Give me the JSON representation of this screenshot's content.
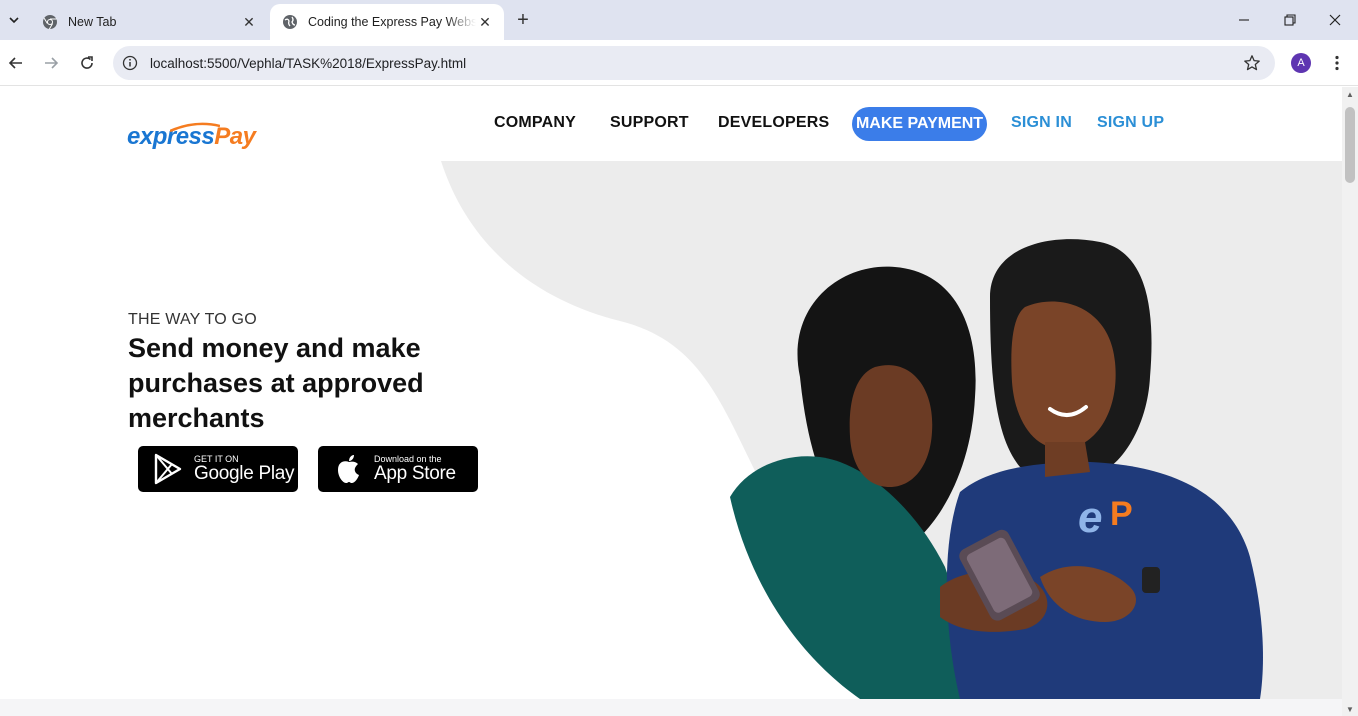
{
  "browser": {
    "tabs": [
      {
        "title": "New Tab",
        "active": false
      },
      {
        "title": "Coding the Express Pay Website",
        "active": true
      }
    ],
    "url": "localhost:5500/Vephla/TASK%2018/ExpressPay.html",
    "profile_initial": "A"
  },
  "site": {
    "logo": {
      "part1": "express",
      "part2": "Pay"
    },
    "nav": {
      "company": "COMPANY",
      "support": "SUPPORT",
      "developers": "DEVELOPERS",
      "make_payment": "MAKE PAYMENT",
      "sign_in": "SIGN IN",
      "sign_up": "SIGN UP"
    },
    "hero": {
      "eyebrow": "THE WAY TO GO",
      "headline": "Send money and make purchases at approved merchants"
    },
    "stores": {
      "google": {
        "small": "GET IT ON",
        "big": "Google Play"
      },
      "apple": {
        "small": "Download on the",
        "big": "App Store"
      }
    },
    "shirt_logo": {
      "e": "e",
      "p": "P"
    }
  },
  "colors": {
    "cta": "#3b7de9",
    "link": "#2b8fd6",
    "logo_blue": "#1976d2",
    "logo_orange": "#f57c20",
    "hero_shape": "#ececec"
  },
  "icons": [
    "chevron-down-icon",
    "chrome-icon",
    "globe-icon",
    "close-icon",
    "plus-icon",
    "minimize-icon",
    "restore-icon",
    "back-arrow-icon",
    "forward-arrow-icon",
    "reload-icon",
    "info-icon",
    "star-icon",
    "more-vert-icon",
    "google-play-icon",
    "apple-icon"
  ]
}
